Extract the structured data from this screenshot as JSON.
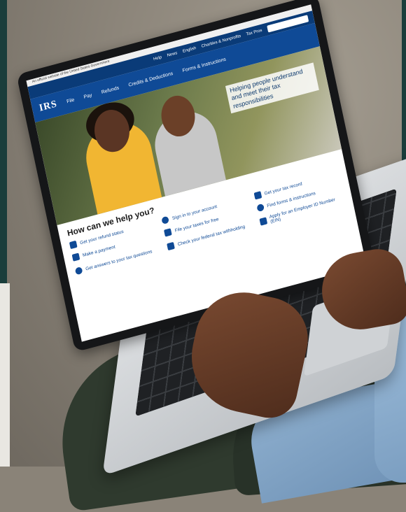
{
  "screen": {
    "gov_banner": "An official website of the United States Government",
    "topbar": [
      "Help",
      "News",
      "English",
      "Charities & Nonprofits",
      "Tax Pros"
    ],
    "logo": "IRS",
    "nav": [
      "File",
      "Pay",
      "Refunds",
      "Credits & Deductions",
      "Forms & Instructions"
    ],
    "hero_text": "Helping people understand and meet their tax responsibilities",
    "help_heading": "How can we help you?",
    "links": [
      "Get your refund status",
      "Sign in to your account",
      "Get your tax record",
      "Make a payment",
      "File your taxes for free",
      "Find forms & instructions",
      "Get answers to your tax questions",
      "Check your federal tax withholding",
      "Apply for an Employer ID Number (EIN)"
    ]
  },
  "colors": {
    "irs_blue": "#0f4a96",
    "irs_dark": "#0a3b78"
  }
}
